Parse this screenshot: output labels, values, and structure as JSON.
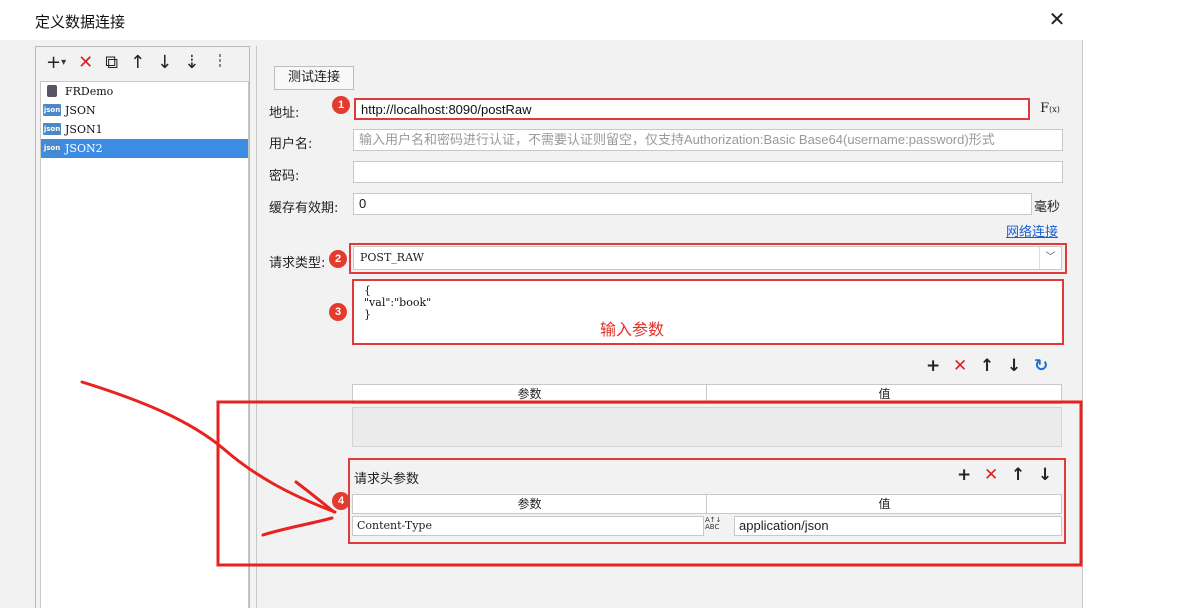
{
  "window": {
    "title": "定义数据连接",
    "close_glyph": "✕"
  },
  "left": {
    "toolbar": {
      "add": "+",
      "add_menu": "▾",
      "delete": "✕",
      "copy": "⧉",
      "up": "↑",
      "down": "↓",
      "sort": "⇣"
    },
    "tree": [
      {
        "label": "FRDemo",
        "icon": "database-icon",
        "icon_text": ""
      },
      {
        "label": "JSON",
        "icon": "json-icon",
        "icon_text": "json"
      },
      {
        "label": "JSON1",
        "icon": "json-icon",
        "icon_text": "json"
      },
      {
        "label": "JSON2",
        "icon": "json-icon",
        "icon_text": "json",
        "selected": true
      }
    ]
  },
  "form": {
    "test_button": "测试连接",
    "address_label": "地址:",
    "address_value": "http://localhost:8090/postRaw",
    "fx_label": "F",
    "fx_sub": "(x)",
    "username_label": "用户名:",
    "username_placeholder": "输入用户名和密码进行认证，不需要认证则留空，仅支持Authorization:Basic Base64(username:password)形式",
    "password_label": "密码:",
    "password_value": "",
    "cache_label": "缓存有效期:",
    "cache_value": "0",
    "cache_unit": "毫秒",
    "network_link": "网络连接",
    "request_type_label": "请求类型:",
    "request_type_value": "POST_RAW",
    "request_type_arrow": "﹀",
    "body_text": "{\n\"val\":\"book\"\n}",
    "body_hint": "输入参数"
  },
  "params_table": {
    "icons": {
      "add": "+",
      "delete": "✕",
      "up": "↑",
      "down": "↓",
      "refresh": "↻"
    },
    "col_param": "参数",
    "col_value": "值"
  },
  "headers_table": {
    "title": "请求头参数",
    "icons": {
      "add": "+",
      "delete": "✕",
      "up": "↑",
      "down": "↓"
    },
    "col_param": "参数",
    "col_value": "值",
    "rows": [
      {
        "param": "Content-Type",
        "type_icon_text": "A↑↓\nABC",
        "value": "application/json"
      }
    ]
  },
  "badges": [
    "1",
    "2",
    "3",
    "4"
  ],
  "colors": {
    "annotation_red": "#e03a3a",
    "selection_blue": "#3c8ce4",
    "link_blue": "#1a5fd0"
  }
}
